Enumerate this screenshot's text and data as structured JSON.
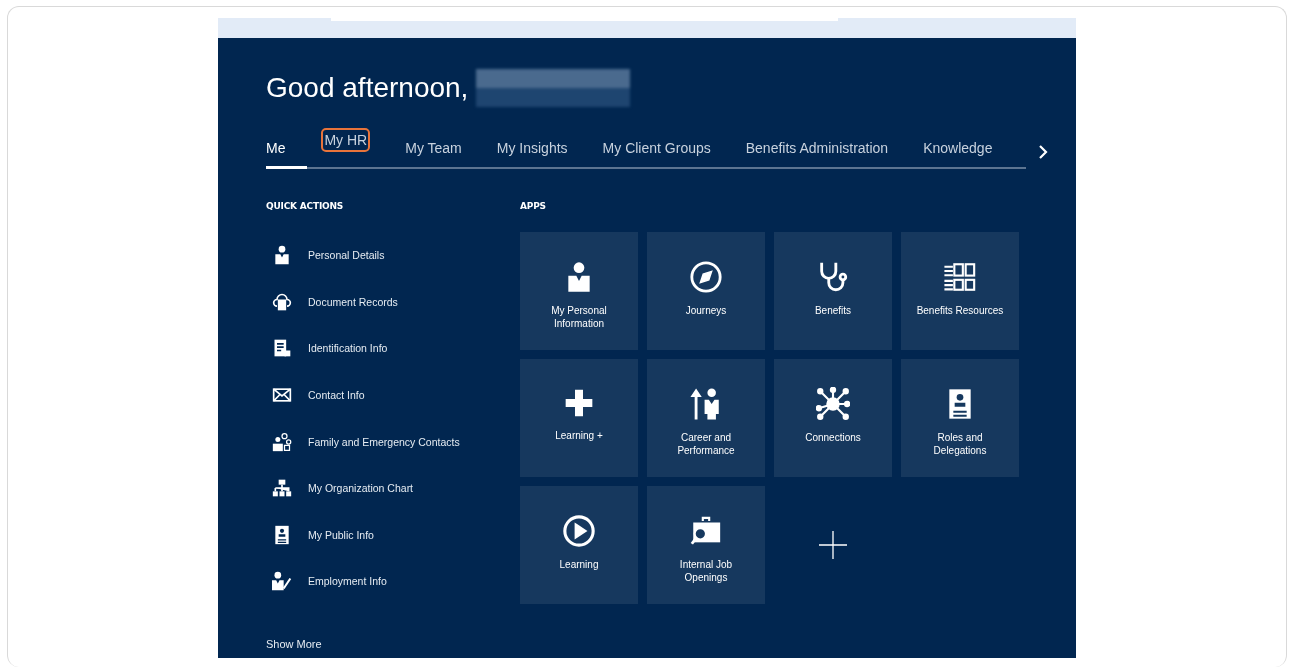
{
  "greeting": "Good afternoon,",
  "tabs": [
    {
      "label": "Me",
      "selected": true,
      "highlighted": false
    },
    {
      "label": "My HR",
      "selected": false,
      "highlighted": true
    },
    {
      "label": "My Team",
      "selected": false,
      "highlighted": false
    },
    {
      "label": "My Insights",
      "selected": false,
      "highlighted": false
    },
    {
      "label": "My Client Groups",
      "selected": false,
      "highlighted": false
    },
    {
      "label": "Benefits Administration",
      "selected": false,
      "highlighted": false
    },
    {
      "label": "Knowledge",
      "selected": false,
      "highlighted": false
    }
  ],
  "quick_actions": {
    "title": "QUICK ACTIONS",
    "items": [
      "Personal Details",
      "Document Records",
      "Identification Info",
      "Contact Info",
      "Family and Emergency Contacts",
      "My Organization Chart",
      "My Public Info",
      "Employment Info"
    ],
    "show_more": "Show More"
  },
  "apps": {
    "title": "APPS",
    "tiles": [
      {
        "kind": "app",
        "label": "My Personal Information"
      },
      {
        "kind": "app",
        "label": "Journeys"
      },
      {
        "kind": "app",
        "label": "Benefits"
      },
      {
        "kind": "app",
        "label": "Benefits Resources"
      },
      {
        "kind": "app",
        "label": "Learning +"
      },
      {
        "kind": "app",
        "label": "Career and Performance"
      },
      {
        "kind": "app",
        "label": "Connections"
      },
      {
        "kind": "app",
        "label": "Roles and Delegations"
      },
      {
        "kind": "app",
        "label": "Learning"
      },
      {
        "kind": "app",
        "label": "Internal Job Openings"
      },
      {
        "kind": "add"
      }
    ]
  }
}
